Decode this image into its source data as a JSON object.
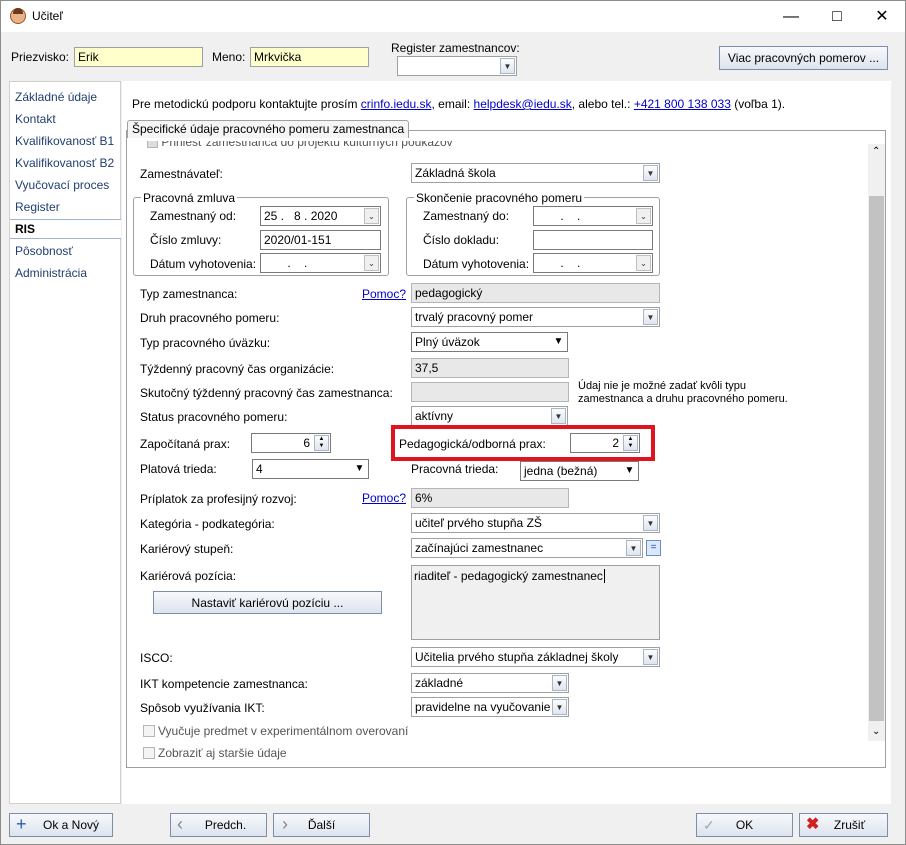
{
  "window": {
    "title": "Učiteľ"
  },
  "header": {
    "surname_label": "Priezvisko:",
    "surname_value": "Erik",
    "name_label": "Meno:",
    "name_value": "Mrkvička",
    "register_label": "Register zamestnancov:",
    "register_value": "",
    "more_relations_button": "Viac pracovných pomerov ..."
  },
  "sidebar": {
    "items": [
      {
        "label": "Základné údaje"
      },
      {
        "label": "Kontakt"
      },
      {
        "label": "Kvalifikovanosť B1"
      },
      {
        "label": "Kvalifikovanosť B2"
      },
      {
        "label": "Vyučovací proces"
      },
      {
        "label": "Register"
      },
      {
        "label": "RIS"
      },
      {
        "label": "Pôsobnosť"
      },
      {
        "label": "Administrácia"
      }
    ]
  },
  "info": {
    "text1": "Pre metodickú podporu kontaktujte prosím ",
    "link1": "crinfo.iedu.sk",
    "text2": ", email: ",
    "link2": "helpdesk@iedu.sk",
    "text3": ", alebo tel.: ",
    "link3": "+421 800 138 033",
    "text4": " (voľba 1)."
  },
  "tab": {
    "title": "Špecifické údaje pracovného pomeru zamestnanca"
  },
  "form": {
    "cut_checkbox_label": "Priniesť zamestnanca do projektu kultúrnych poukazov",
    "employer_label": "Zamestnávateľ:",
    "employer_value": "Základná škola",
    "contract_group": "Pracovná zmluva",
    "employed_from_label": "Zamestnaný od:",
    "employed_from_value": "25 .   8 . 2020",
    "contract_number_label": "Číslo zmluvy:",
    "contract_number_value": "2020/01-151",
    "issue_date_label": "Dátum vyhotovenia:",
    "issue_date_value": " .    .",
    "end_group": "Skončenie pracovného pomeru",
    "employed_to_label": "Zamestnaný do:",
    "employed_to_value": " .    .",
    "document_number_label": "Číslo dokladu:",
    "document_number_value": "",
    "end_issue_date_label": "Dátum vyhotovenia:",
    "end_issue_date_value": " .    .",
    "employee_type_label": "Typ zamestnanca:",
    "help_link": "Pomoc?",
    "employee_type_value": "pedagogický",
    "relation_kind_label": "Druh pracovného pomeru:",
    "relation_kind_value": "trvalý pracovný pomer",
    "workload_type_label": "Typ pracovného úväzku:",
    "workload_type_value": "Plný úväzok",
    "weekly_org_label": "Týždenný pracovný čas organizácie:",
    "weekly_org_value": "37,5",
    "weekly_actual_label": "Skutočný týždenný pracovný čas zamestnanca:",
    "weekly_actual_value": "",
    "weekly_note": "Údaj nie je možné zadať kvôli typu zamestnanca a druhu pracovného pomeru.",
    "status_label": "Status pracovného pomeru:",
    "status_value": "aktívny",
    "counted_practice_label": "Započítaná prax:",
    "counted_practice_value": "6",
    "ped_practice_label": "Pedagogická/odborná prax:",
    "ped_practice_value": "2",
    "salary_class_label": "Platová trieda:",
    "salary_class_value": "4",
    "work_class_label": "Pracovná trieda:",
    "work_class_value": "jedna (bežná)",
    "prof_bonus_label": "Príplatok za profesijný rozvoj:",
    "help_link2": "Pomoc?",
    "prof_bonus_value": "6%",
    "category_label": "Kategória - podkategória:",
    "category_value": "učiteľ prvého stupňa ZŠ",
    "career_level_label": "Kariérový stupeň:",
    "career_level_value": "začínajúci zamestnanec",
    "career_level_extra": "=",
    "career_position_label": "Kariérová pozícia:",
    "career_position_value": "riaditeľ - pedagogický zamestnanec",
    "set_position_button": "Nastaviť kariérovú pozíciu ...",
    "isco_label": "ISCO:",
    "isco_value": "Učitelia prvého stupňa základnej školy",
    "ict_comp_label": "IKT kompetencie zamestnanca:",
    "ict_comp_value": "základné",
    "ict_usage_label": "Spôsob využívania IKT:",
    "ict_usage_value": "pravidelne na vyučovanie",
    "experimental_label": "Vyučuje predmet v experimentálnom overovaní",
    "older_label": "Zobraziť aj staršie údaje"
  },
  "footer": {
    "ok_new": "Ok a Nový",
    "prev": "Predch.",
    "next": "Ďalší",
    "ok": "OK",
    "cancel": "Zrušiť"
  },
  "colors": {
    "highlight": "#e0141e",
    "yellow_field": "#ffffcc",
    "link": "#0000cc"
  }
}
